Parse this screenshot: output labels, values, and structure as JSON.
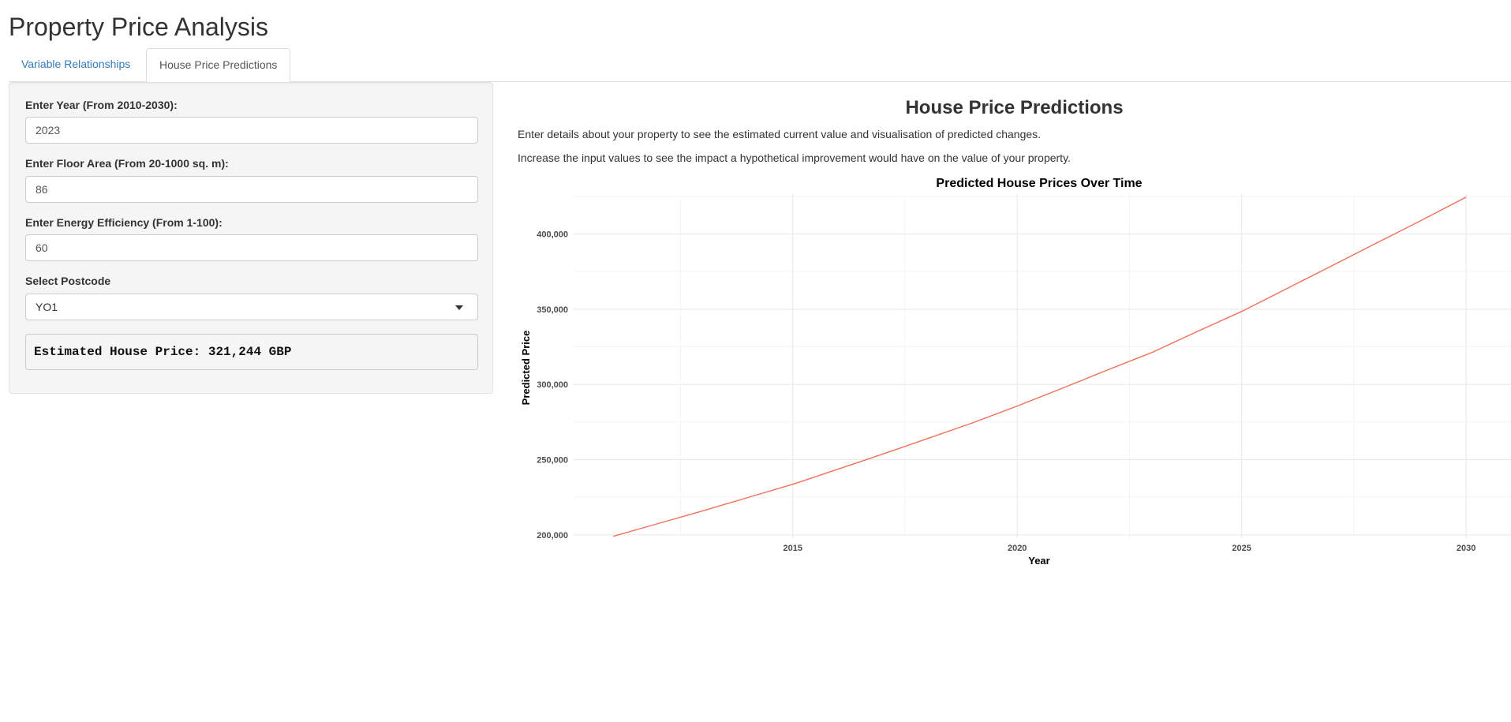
{
  "app": {
    "title": "Property Price Analysis"
  },
  "tabs": [
    {
      "label": "Variable Relationships",
      "active": false
    },
    {
      "label": "House Price Predictions",
      "active": true
    }
  ],
  "sidebar": {
    "year": {
      "label": "Enter Year (From 2010-2030):",
      "value": "2023"
    },
    "floor_area": {
      "label": "Enter Floor Area (From 20-1000 sq. m):",
      "value": "86"
    },
    "energy": {
      "label": "Enter Energy Efficiency (From 1-100):",
      "value": "60"
    },
    "postcode": {
      "label": "Select Postcode",
      "value": "YO1"
    },
    "estimate": "Estimated House Price: 321,244 GBP"
  },
  "main": {
    "title": "House Price Predictions",
    "description_1": "Enter details about your property to see the estimated current value and visualisation of predicted changes.",
    "description_2": "Increase the input values to see the impact a hypothetical improvement would have on the value of your property."
  },
  "colors": {
    "line": "#f07058",
    "grid_major": "#ebebeb",
    "grid_minor": "#f5f5f5"
  },
  "chart_data": {
    "type": "line",
    "title": "Predicted House Prices Over Time",
    "xlabel": "Year",
    "ylabel": "Predicted Price",
    "xlim": [
      2010.1,
      2031.0
    ],
    "ylim": [
      197800,
      426500
    ],
    "x_ticks": [
      2015,
      2020,
      2025,
      2030
    ],
    "x_tick_labels": [
      "2015",
      "2020",
      "2025",
      "2030"
    ],
    "y_ticks": [
      200000,
      250000,
      300000,
      350000,
      400000
    ],
    "y_tick_labels": [
      "200,000",
      "250,000",
      "300,000",
      "350,000",
      "400,000"
    ],
    "grid": true,
    "legend": "none",
    "series": [
      {
        "x": [
          2011,
          2012,
          2013,
          2014,
          2015,
          2016,
          2017,
          2018,
          2019,
          2020,
          2021,
          2022,
          2023,
          2024,
          2025,
          2026,
          2027,
          2028,
          2029,
          2030
        ],
        "values": [
          199000,
          207500,
          216000,
          224800,
          233600,
          243600,
          253600,
          264000,
          274400,
          285600,
          297400,
          309500,
          321244,
          335000,
          348500,
          363600,
          378700,
          393900,
          409000,
          424500
        ]
      }
    ]
  }
}
